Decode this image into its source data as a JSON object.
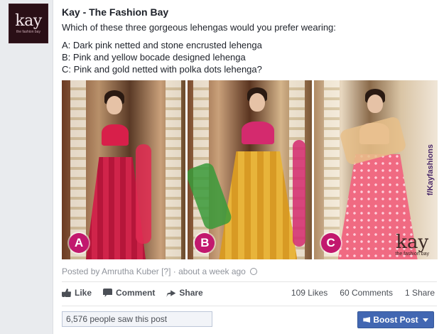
{
  "avatar": {
    "logo": "kay",
    "sub": "the fashion bay"
  },
  "post": {
    "page_name": "Kay - The Fashion Bay",
    "question": "Which of these three gorgeous lehengas would you prefer wearing:",
    "options": [
      "A: Dark pink netted and stone encrusted lehenga",
      "B: Pink and yellow bocade designed lehenga",
      "C: Pink and gold netted with polka dots lehenga?"
    ]
  },
  "photos": [
    {
      "badge": "A",
      "colors": {
        "bg": "#7a4a2c",
        "top": "#d81f4a",
        "skirt": "#c2183c",
        "dupatta": "#e02a52"
      }
    },
    {
      "badge": "B",
      "colors": {
        "bg": "#8a5a34",
        "top": "#d42a6e",
        "skirt": "#e0a22a",
        "dupatta": "#3a9a3a"
      }
    },
    {
      "badge": "C",
      "colors": {
        "bg": "#8a6a4a",
        "top": "#f2c0b0",
        "skirt": "#f06a82",
        "dupatta": "#e8c08a"
      },
      "watermark": {
        "logo": "kay",
        "sub": "the fashion bay"
      },
      "handle": "f/Kayfashions"
    }
  ],
  "meta": {
    "posted_by": "Posted by Amrutha Kuber",
    "help": "[?]",
    "time": "· about a week ago"
  },
  "actions": {
    "like": "Like",
    "comment": "Comment",
    "share": "Share"
  },
  "stats": {
    "likes": "109 Likes",
    "comments": "60 Comments",
    "shares": "1 Share"
  },
  "reach": "6,576 people saw this post",
  "boost": "Boost Post",
  "colors": {
    "accent": "#4267b2",
    "badge": "#c2186e",
    "text": "#1d2129",
    "muted": "#90949c"
  }
}
